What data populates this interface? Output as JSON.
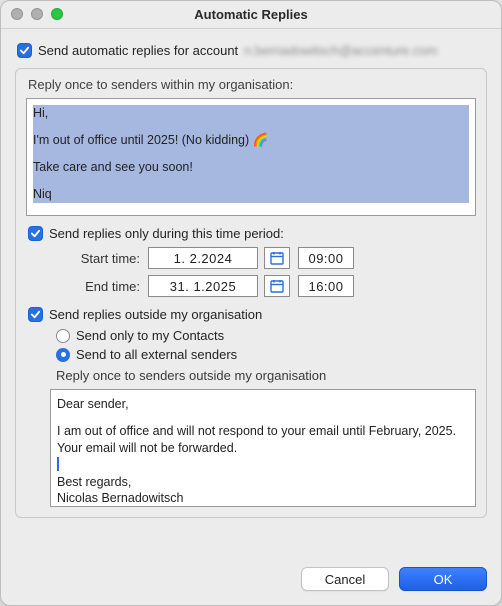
{
  "window": {
    "title": "Automatic Replies"
  },
  "account": {
    "label": "Send automatic replies for account",
    "value": "n.bernadowitsch@accenture.com"
  },
  "internal": {
    "header": "Reply once to senders within my organisation:",
    "body": {
      "line1": "Hi,",
      "line2": "I'm out of office until 2025! (No kidding) 🌈",
      "line3": "Take care and see you soon!",
      "line4": "Niq"
    }
  },
  "period": {
    "label": "Send replies only during this time period:",
    "start_label": "Start time:",
    "end_label": "End time:",
    "start_date": "1.  2.2024",
    "start_time": "09:00",
    "end_date": "31.  1.2025",
    "end_time": "16:00"
  },
  "external": {
    "enable_label": "Send replies outside my organisation",
    "radio_contacts": "Send only to my Contacts",
    "radio_all": "Send to all external senders",
    "header": "Reply once to senders outside my organisation",
    "body": {
      "line1": "Dear sender,",
      "line2": "I am out of office and will not respond to your email until February, 2025. Your email will not be forwarded.",
      "line3": "Best regards,",
      "line4": "Nicolas Bernadowitsch"
    }
  },
  "footer": {
    "cancel": "Cancel",
    "ok": "OK"
  }
}
